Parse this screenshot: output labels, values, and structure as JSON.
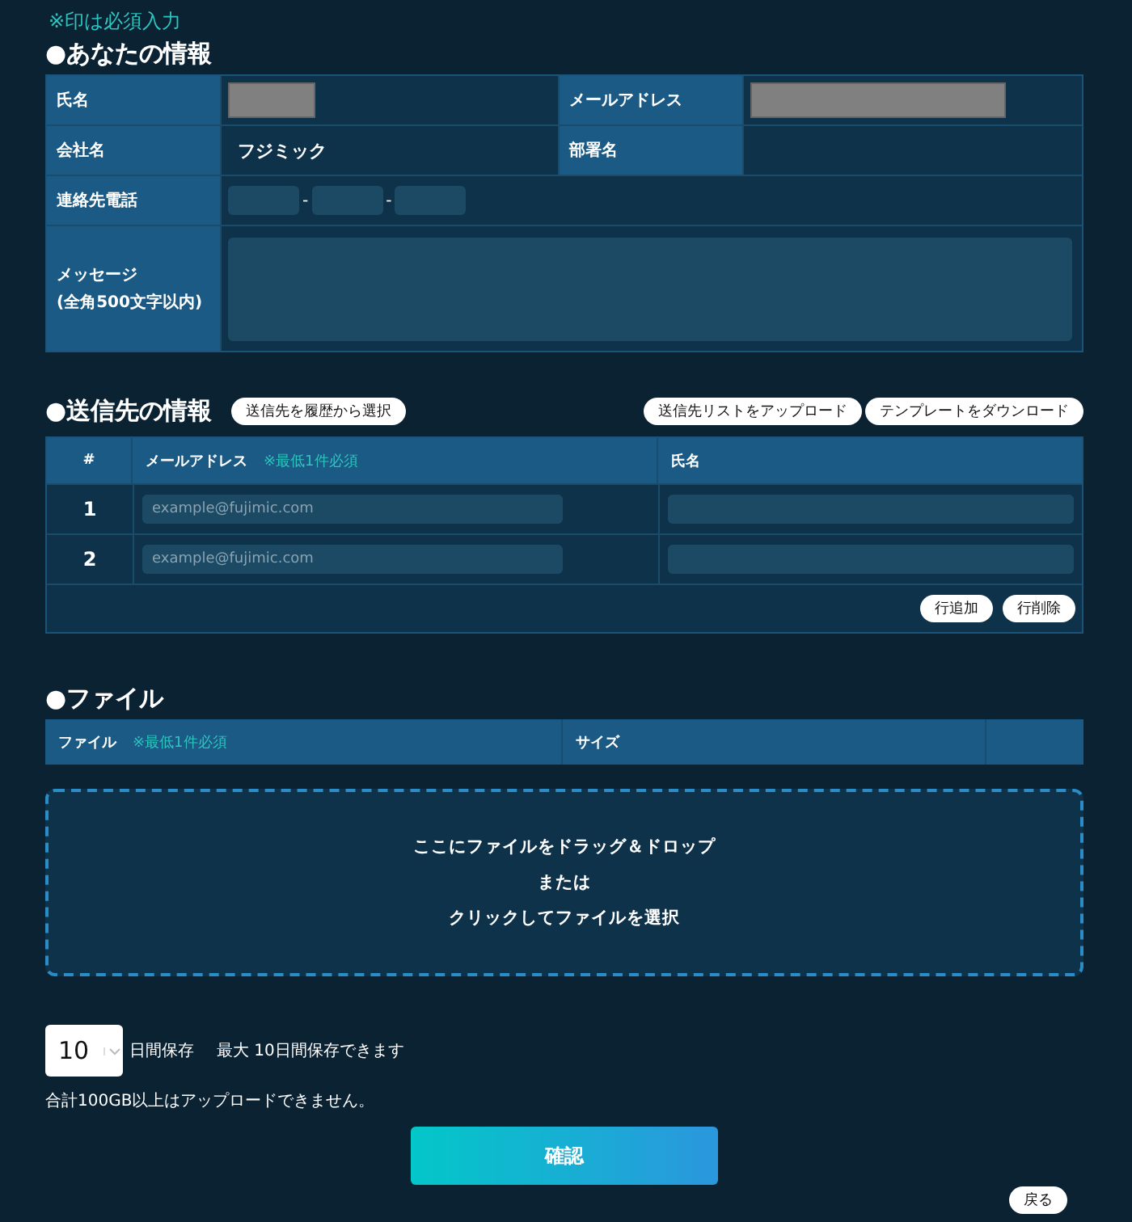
{
  "required_note": "※印は必須入力",
  "your_info": {
    "heading": "●あなたの情報",
    "name": {
      "label": "氏名",
      "redacted": true
    },
    "email": {
      "label": "メールアドレス",
      "redacted": true
    },
    "company": {
      "label": "会社名",
      "value": "フジミック"
    },
    "department": {
      "label": "部署名"
    },
    "phone": {
      "label": "連絡先電話",
      "separators": [
        "-",
        "-"
      ]
    },
    "message": {
      "label": "メッセージ",
      "sublabel": "(全角500文字以内)"
    }
  },
  "recipients": {
    "heading": "●送信先の情報",
    "history_button": "送信先を履歴から選択",
    "upload_button": "送信先リストをアップロード",
    "template_button": "テンプレートをダウンロード",
    "columns": [
      {
        "label": "#"
      },
      {
        "label": "メールアドレス",
        "note": "※最低1件必須"
      },
      {
        "label": "氏名"
      }
    ],
    "rows": [
      {
        "number": "1",
        "email_placeholder": "example@fujimic.com"
      },
      {
        "number": "2",
        "email_placeholder": "example@fujimic.com"
      }
    ],
    "add_row_button": "行追加",
    "delete_row_button": "行削除"
  },
  "files": {
    "heading": "●ファイル",
    "columns": [
      {
        "label": "ファイル",
        "note": "※最低1件必須"
      },
      {
        "label": "サイズ"
      }
    ],
    "dropzone_lines": [
      "ここにファイルをドラッグ＆ドロップ",
      "または",
      "クリックしてファイルを選択"
    ]
  },
  "retention": {
    "days": "10",
    "unit": "日間保存",
    "max_note": "最大 10日間保存できます"
  },
  "limit_note": "合計100GB以上はアップロードできません。",
  "confirm_button": "確認",
  "back_button": "戻る"
}
